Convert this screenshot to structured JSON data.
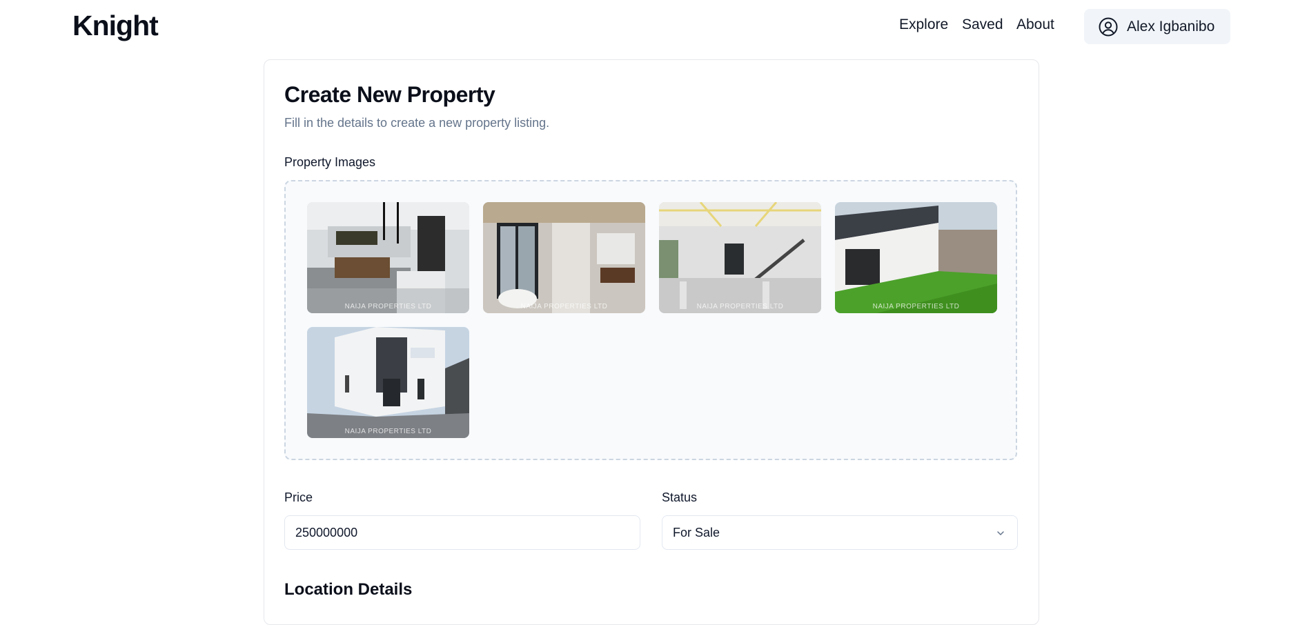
{
  "app": {
    "logo": "Knight"
  },
  "nav": {
    "explore": "Explore",
    "saved": "Saved",
    "about": "About"
  },
  "user": {
    "name": "Alex Igbanibo",
    "icon": "user-circle-icon"
  },
  "form": {
    "title": "Create New Property",
    "subtitle": "Fill in the details to create a new property listing.",
    "images_label": "Property Images",
    "images": [
      {
        "alt": "kitchen",
        "watermark": "NAIJA PROPERTIES LTD"
      },
      {
        "alt": "bathroom",
        "watermark": "NAIJA PROPERTIES LTD"
      },
      {
        "alt": "living-room",
        "watermark": "NAIJA PROPERTIES LTD"
      },
      {
        "alt": "backyard",
        "watermark": "NAIJA PROPERTIES LTD"
      },
      {
        "alt": "exterior",
        "watermark": "NAIJA PROPERTIES LTD"
      }
    ],
    "price_label": "Price",
    "price_value": "250000000",
    "status_label": "Status",
    "status_value": "For Sale",
    "location_section": "Location Details"
  },
  "colors": {
    "accent_bg": "#f1f5f9",
    "muted_text": "#64748b",
    "border": "#e2e8f0"
  }
}
